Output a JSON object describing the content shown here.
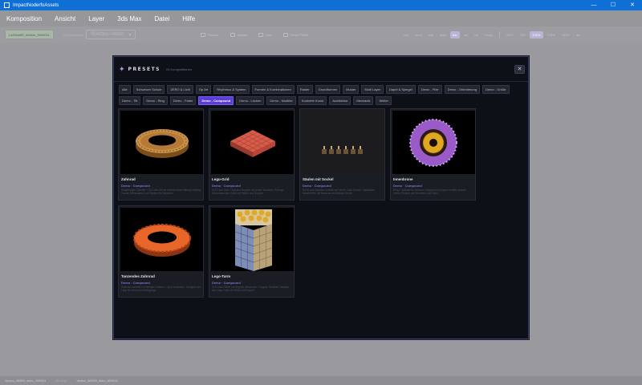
{
  "window": {
    "title": "ImpactNoderfoAssets"
  },
  "window_buttons": [
    "—",
    "☐",
    "✕"
  ],
  "menu": [
    "Komposition",
    "Ansicht",
    "Layer",
    "3ds Max",
    "Datei",
    "Hilfe"
  ],
  "toolbar": {
    "project": "LASSAMÉ_Motion_3000011",
    "select_label": "Stücknummer",
    "select_value": "Rüstbox-Atelier",
    "tools": [
      "Presets",
      "Update",
      "Max",
      "Reset Felsfit"
    ],
    "toggles": [
      "Stp",
      "mem",
      "edit",
      "fight",
      "bar",
      "ms",
      "VA",
      "Stngs",
      "50%",
      "75%",
      "100%",
      "125%",
      "150%",
      "4K"
    ]
  },
  "status": {
    "left": "Version_360829_dekro_3000011",
    "mid": "88 cm/px",
    "right": "Version_360029_dekro_3000011"
  },
  "modal": {
    "title": "PRESETS",
    "count": "24 Kompositionen",
    "close": "✕",
    "filters": [
      "Alle",
      "Schweizer Schule",
      "ZERO & Licht",
      "Op Art",
      "Rhythmus & System",
      "Formen & Kombinationen",
      "Raster",
      "Grundformen",
      "Muster",
      "Multi Layer",
      "Dapel & Spiegel",
      "Demo - Filer",
      "Demo - Orientierung",
      "Demo - Größe",
      "Demo - Tilt",
      "Demo - Ring",
      "Demo - Farbe",
      "Demo - Compound",
      "Demo - Lücken",
      "Demo - Modifier",
      "Konkrete Kunst",
      "Architektur",
      "Mechanik",
      "Weiter"
    ],
    "active_filter": "Demo - Compound",
    "cards": [
      {
        "name": "Zahnrad",
        "category": "Demo · Compound",
        "desc": "Ringförmiger Zylinder + 24 Cube-Zähne verteilt radial entlang Umfang. Tweak Zähnekanten und Radien für Varianten."
      },
      {
        "name": "Lego-Grid",
        "category": "Demo · Compound",
        "desc": "5×5 Cube-Grid + Zylinder-Noppen auf jedem Baustein. Erzeugt Klemmbaustein-Optik mit Raster und Noppen."
      },
      {
        "name": "Säulen mit Sockel",
        "category": "Demo · Compound",
        "desc": "Reihe aus Zylindern jeweils auf einem Cube-Sockel. Klassische Säulenreihe mit Basis als Architektur-Studie."
      },
      {
        "name": "Innenbrone",
        "category": "Demo · Compound",
        "desc": "Ring + Zylinder im Zentrum, Noppen und Kugeln verteilt rundum. Innere Struktur mit Sternform und Rand."
      },
      {
        "name": "Tanzendes Zahnrad",
        "category": "Demo · Compound",
        "desc": "Zahnrad-Variante mit farbigen Zähnen + Spin-Animation. Geeignet als Loop für Intros und Übergänge."
      },
      {
        "name": "Lego-Turm",
        "category": "Demo · Compound",
        "desc": "3×3 Cube-Säule mit Noppen-Abschluss + Kugeln. Vertikale Variante des Lego-Grids mit Höhe und Kuppel."
      }
    ]
  },
  "colors": {
    "titlebar": "#0e6fd6",
    "modal_bg": "#0e1018",
    "accent": "#5c3dd6",
    "category": "#7d6fcf"
  }
}
